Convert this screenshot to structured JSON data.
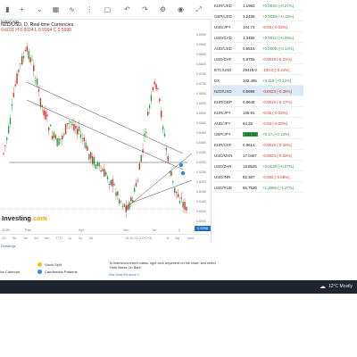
{
  "header": {
    "pair_label": "NZD/USD"
  },
  "chart": {
    "title": "NZD/USD, D, Real-time Currencies",
    "ohlc_text": "0.6011  H 0.6024  L 0.5994  C 0.5998",
    "price_tag": "0.5998",
    "logo_text": "Investing",
    "logo_suffix": ".com",
    "price_axis": [
      "0.6950",
      "0.6900",
      "0.6850",
      "0.6800",
      "0.6750",
      "0.6700",
      "0.6650",
      "0.6600",
      "0.6550",
      "0.6500",
      "0.6450",
      "0.6400",
      "0.6350",
      "0.6300",
      "0.6250",
      "0.6200",
      "0.6150",
      "0.6100",
      "0.6050",
      "0.6000"
    ],
    "x_labels": [
      "2020",
      "Feb",
      "Apr",
      "Jun",
      "Jul",
      "2"
    ],
    "bottom_items": [
      "1D",
      "5d",
      "1m",
      "3m",
      "6m",
      "YTD",
      "1y",
      "5y",
      "All",
      "18:45:33 (UTC+3)",
      "%",
      "log",
      "auto"
    ]
  },
  "quotes": [
    {
      "sym": "EUR/USD",
      "last": "1.1982",
      "chg": "+0.0032 (+0.27%)",
      "dir": "pos"
    },
    {
      "sym": "GBP/USD",
      "last": "1.2498",
      "chg": "+0.0028 (+0.18%)",
      "dir": "pos"
    },
    {
      "sym": "USD/JPY",
      "last": "104.73",
      "chg": "-0.03 (-0.03%)",
      "dir": "neg"
    },
    {
      "sym": "USD/CAD",
      "last": "1.3456",
      "chg": "+0.0012 (+0.09%)",
      "dir": "pos"
    },
    {
      "sym": "AUD/USD",
      "last": "0.6515",
      "chg": "+0.0009 (+0.14%)",
      "dir": "pos"
    },
    {
      "sym": "USD/CHF",
      "last": "0.8755",
      "chg": "-0.0018 (-0.21%)",
      "dir": "neg"
    },
    {
      "sym": "BTC/USD",
      "last": "29415.0",
      "chg": "-130.0 (-0.44%)",
      "dir": "neg"
    },
    {
      "sym": "DX",
      "last": "102.485",
      "chg": "+0.118 (+0.12%)",
      "dir": "pos"
    },
    {
      "sym": "NZD/USD",
      "last": "0.5998",
      "chg": "-0.0023 (-0.38%)",
      "dir": "neg",
      "active": true
    },
    {
      "sym": "EUR/GBP",
      "last": "0.8648",
      "chg": "-0.0015 (-0.17%)",
      "dir": "neg"
    },
    {
      "sym": "EUR/JPY",
      "last": "156.91",
      "chg": "-0.05 (-0.03%)",
      "dir": "neg"
    },
    {
      "sym": "AUD/JPY",
      "last": "94.28",
      "chg": "-0.03 (-0.03%)",
      "dir": "neg"
    },
    {
      "sym": "GBP/JPY",
      "last": "131.54",
      "chg": "+0.17 (+0.13%)",
      "dir": "pos",
      "badge": true
    },
    {
      "sym": "EUR/CHF",
      "last": "0.9614",
      "chg": "-0.0015 (-0.16%)",
      "dir": "neg"
    },
    {
      "sym": "USD/MXN",
      "last": "17.0467",
      "chg": "-0.0023 (-0.02%)",
      "dir": "neg"
    },
    {
      "sym": "USD/ZAR",
      "last": "18.8545",
      "chg": "+0.0139 (+0.07%)",
      "dir": "pos"
    },
    {
      "sym": "USD/INR",
      "last": "82.387",
      "chg": "-0.063 (-0.08%)",
      "dir": "neg"
    },
    {
      "sym": "USD/RUB",
      "last": "86.7520",
      "chg": "+1.2965 (+1.37%)",
      "dir": "pos"
    }
  ],
  "below": {
    "drawings_link": "Drawings",
    "legend_left": "ics Calendar",
    "legend_stock": "Stock Split",
    "legend_candle": "Candlestick Patterns",
    "help_text": "To hide/show event marks, right click anywhere on the chart, and select \"Hide Marks On Bars\"",
    "help_link": "See How It's done »"
  },
  "taskbar": {
    "weather": "12°C  Mostly"
  },
  "colors": {
    "up": "#2e9b45",
    "down": "#d2322d",
    "accent": "#1f6fc5",
    "taskbar": "#1f2430"
  }
}
